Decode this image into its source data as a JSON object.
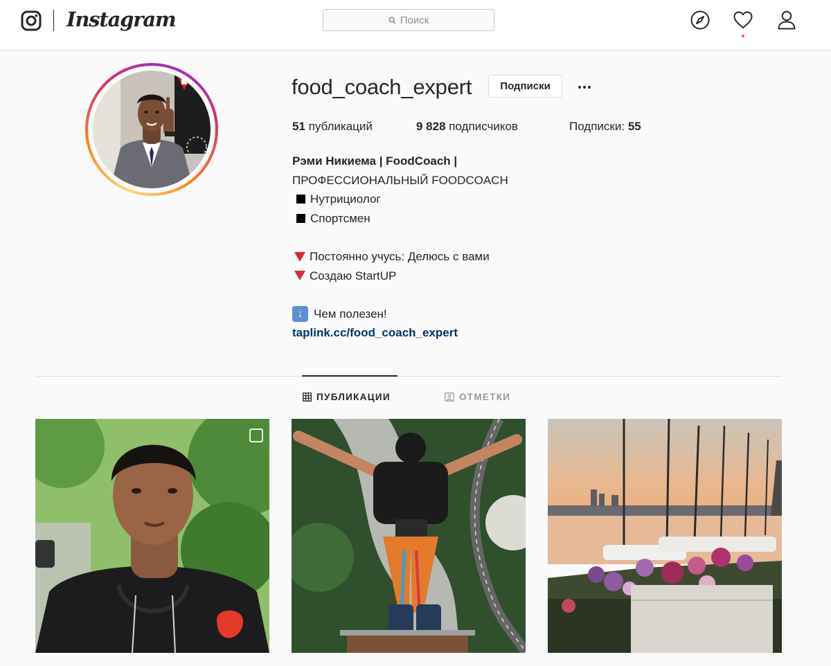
{
  "nav": {
    "logo_text": "Instagram",
    "search_placeholder": "Поиск",
    "has_notification": true
  },
  "profile": {
    "username": "food_coach_expert",
    "follow_button_label": "Подписки",
    "stats": {
      "posts_count": "51",
      "posts_label": " публикаций",
      "followers_count": "9 828",
      "followers_label": " подписчиков",
      "following_label": "Подписки: ",
      "following_count": "55"
    },
    "bio": {
      "name": "Рэми Никиема | FoodCoach |",
      "lines": [
        "ПРОФЕССИОНАЛЬНЫЙ FOODCOACH",
        "Нутрициолог",
        "Спортсмен",
        "Постоянно учусь: Делюсь с вами",
        "Создаю StartUP",
        "Чем полезен!"
      ],
      "link": "taplink.cc/food_coach_expert"
    }
  },
  "tabs": [
    {
      "label": "ПУБЛИКАЦИИ",
      "active": true
    },
    {
      "label": "ОТМЕТКИ",
      "active": false
    }
  ],
  "colors": {
    "text": "#262626",
    "link": "#003569",
    "notification": "#ed4956",
    "border": "#dbdbdb"
  }
}
